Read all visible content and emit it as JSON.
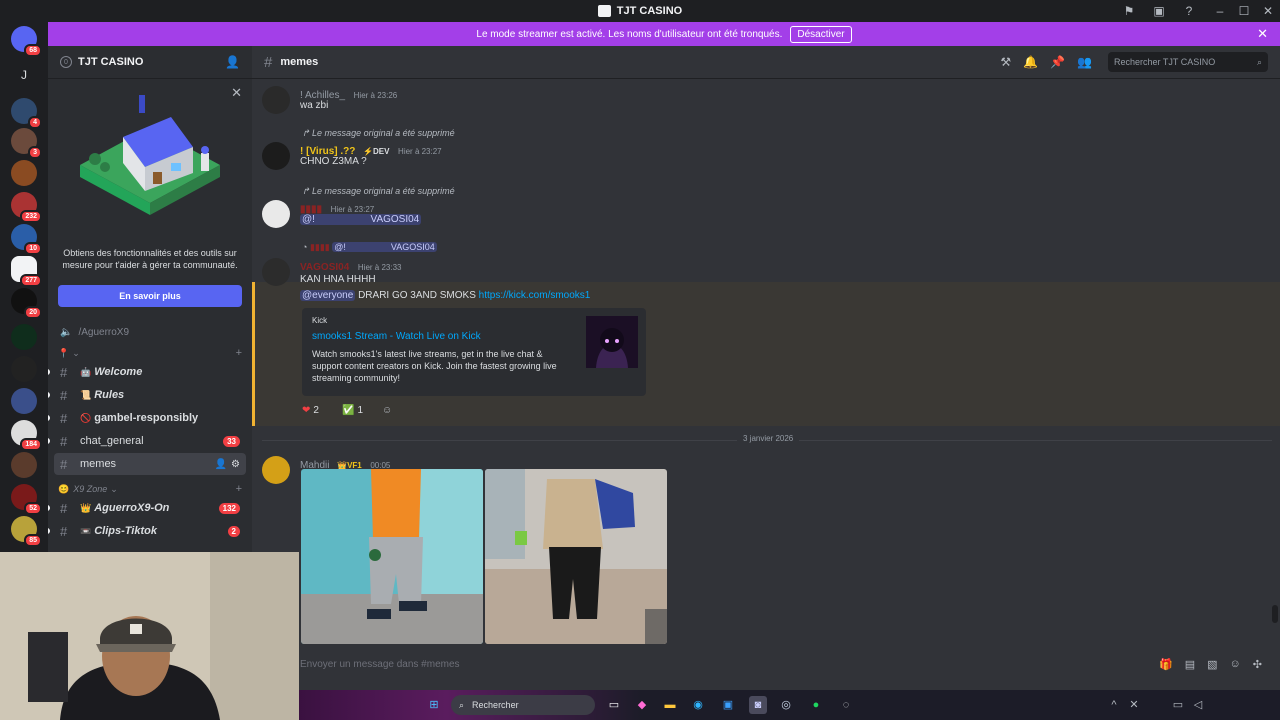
{
  "window": {
    "title": "TJT CASINO"
  },
  "banner": {
    "text": "Le mode streamer est activé. Les noms d'utilisateur ont été tronqués.",
    "button": "Désactiver"
  },
  "rail": {
    "home_badge": "68",
    "j_label": "J",
    "badges": [
      "4",
      "3",
      "232",
      "10",
      "277",
      "20",
      "184",
      "52",
      "85"
    ]
  },
  "server": {
    "name": "TJT CASINO",
    "member_count_badge": "0",
    "promo": {
      "text": "Obtiens des fonctionnalités et des outils sur mesure pour t'aider à gérer ta communauté.",
      "cta": "En savoir plus"
    },
    "voice_user": "/AguerroX9",
    "channels": [
      {
        "name": "Welcome",
        "emoji": "🤖",
        "style": "italic"
      },
      {
        "name": "Rules",
        "emoji": "📜",
        "style": "italic"
      },
      {
        "name": "gambel-responsibly",
        "emoji": "🚫",
        "style": "bold"
      },
      {
        "name": "chat_general",
        "count": "33",
        "style": "plain"
      },
      {
        "name": "memes",
        "style": "plain",
        "active": true
      }
    ],
    "category2": "X9 Zone",
    "channels2": [
      {
        "name": "AguerroX9-On",
        "emoji": "👑",
        "count": "132"
      },
      {
        "name": "Clips-Tiktok",
        "emoji": "📼",
        "count": "2"
      }
    ]
  },
  "channel": {
    "name": "memes",
    "search_placeholder": "Rechercher TJT CASINO"
  },
  "messages": [
    {
      "user": "! Achilles_",
      "time": "Hier à 23:26",
      "text": "wa zbi"
    },
    {
      "reply": "Le message original a été supprimé",
      "user": "! [Virus] .??",
      "badge": "DEV",
      "time": "Hier à 23:27",
      "text": "CHNO Z3MA ?"
    },
    {
      "reply": "Le message original a été supprimé",
      "user": "",
      "time": "Hier à 23:27",
      "mention": "@!",
      "mention2": "VAGOSI04"
    },
    {
      "reply_mention": "@!",
      "reply_name": "VAGOSI04",
      "user": "VAGOSI04",
      "time": "Hier à 23:33",
      "text": "KAN HNA HHHH",
      "text2_mention": "@everyone",
      "text2": "DRARI GO 3AND SMOKS",
      "link": "https://kick.com/smooks1",
      "embed": {
        "provider": "Kick",
        "title": "smooks1 Stream - Watch Live on Kick",
        "description": "Watch smooks1's latest live streams, get in the live chat & support content creators on Kick. Join the fastest growing live streaming community!"
      },
      "reactions": [
        {
          "emoji": "❤",
          "count": "2"
        },
        {
          "emoji": "✅",
          "count": "1"
        }
      ]
    }
  ],
  "date_divider": "3 janvier 2026",
  "last_message": {
    "user": "Mahdii",
    "badge": "VF1",
    "time": "00:05"
  },
  "composer": {
    "placeholder": "Envoyer un message dans #memes"
  },
  "taskbar": {
    "search": "Rechercher"
  }
}
